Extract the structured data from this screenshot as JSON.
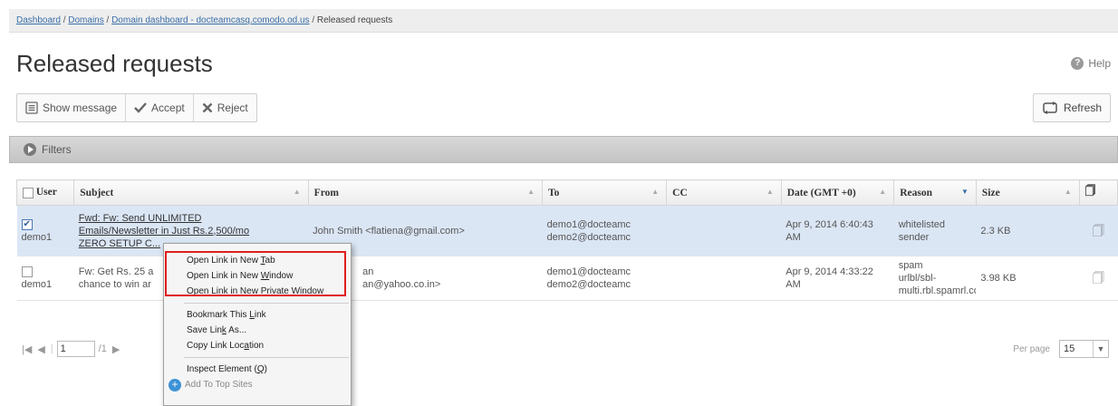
{
  "breadcrumb": {
    "items": [
      "Dashboard",
      "Domains",
      "Domain dashboard - docteamcasq.comodo.od.us",
      "Released requests"
    ],
    "separator": "/"
  },
  "page": {
    "title": "Released requests",
    "help_label": "Help"
  },
  "toolbar": {
    "show_message": "Show message",
    "accept": "Accept",
    "reject": "Reject",
    "refresh": "Refresh"
  },
  "filters": {
    "label": "Filters"
  },
  "table": {
    "columns": [
      "User",
      "Subject",
      "From",
      "To",
      "CC",
      "Date (GMT +0)",
      "Reason",
      "Size",
      ""
    ],
    "rows": [
      {
        "checked": true,
        "user": "demo1",
        "subject_lines": [
          "Fwd: Fw: Send UNLIMITED",
          "Emails/Newsletter in Just Rs.2,500/mo",
          "ZERO SETUP C..."
        ],
        "from": "John Smith <flatiena@gmail.com>",
        "to": [
          "demo1@docteamc",
          "demo2@docteamc"
        ],
        "cc": "",
        "date": [
          "Apr 9, 2014 6:40:43",
          "AM"
        ],
        "reason": [
          "whitelisted",
          "sender"
        ],
        "size": "2.3 KB"
      },
      {
        "checked": false,
        "user": "demo1",
        "subject_lines": [
          "Fw: Get Rs. 25 a",
          "chance to win ar"
        ],
        "from_lines": [
          "an",
          "an@yahoo.co.in>"
        ],
        "to": [
          "demo1@docteamc",
          "demo2@docteamc"
        ],
        "cc": "",
        "date": [
          "Apr 9, 2014 4:33:22",
          "AM"
        ],
        "reason": [
          "spam",
          "urlbl/sbl-",
          "multi.rbl.spamrl.cor"
        ],
        "size": "3.98 KB"
      }
    ]
  },
  "pager": {
    "page_value": "1",
    "page_total": "/1",
    "per_page_label": "Per page",
    "per_page_value": "15"
  },
  "context_menu": {
    "open_new_tab": [
      "Open Link in New ",
      "T",
      "ab"
    ],
    "open_new_window": [
      "Open Link in New ",
      "W",
      "indow"
    ],
    "open_private_window": [
      "Open Link in New ",
      "P",
      "rivate Window"
    ],
    "bookmark_link": [
      "Bookmark This ",
      "L",
      "ink"
    ],
    "save_link": [
      "Save Lin",
      "k",
      " As..."
    ],
    "copy_link": [
      "Copy Link Loc",
      "a",
      "tion"
    ],
    "inspect_element": [
      "Inspect Element (",
      "Q",
      ")"
    ],
    "add_top_sites": "Add To Top Sites"
  },
  "colors": {
    "highlight": "#e01e1e",
    "selected_row": "#dbe6f5",
    "link": "#3a6fa8"
  }
}
